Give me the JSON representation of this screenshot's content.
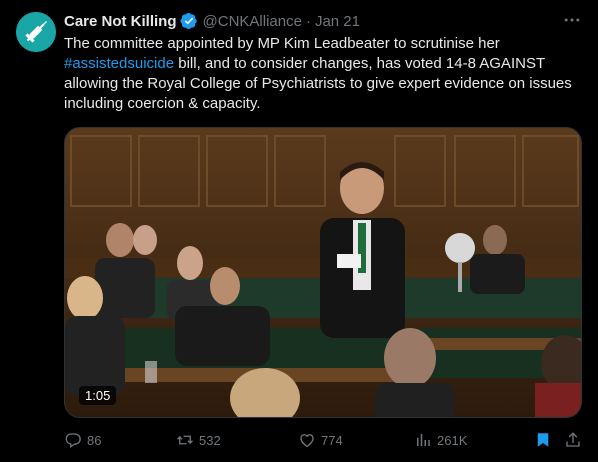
{
  "post": {
    "author_name": "Care Not Killing",
    "handle": "@CNKAlliance",
    "separator": "·",
    "date": "Jan 21",
    "text_part1": "The committee appointed by MP Kim Leadbeater to scrutinise her ",
    "hashtag": "#assistedsuicide",
    "text_part2": " bill, and to consider changes, has voted 14-8 AGAINST allowing the Royal College of Psychiatrists to give expert evidence on issues including coercion & capacity."
  },
  "media": {
    "duration": "1:05"
  },
  "actions": {
    "replies": "86",
    "reposts": "532",
    "likes": "774",
    "views": "261K"
  },
  "colors": {
    "accent": "#1d9bf0",
    "muted": "#71767b",
    "text": "#e7e9ea",
    "avatar_bg": "#1aa6a6"
  },
  "icons": [
    "verified-badge-icon",
    "more-icon",
    "reply-icon",
    "repost-icon",
    "like-icon",
    "views-icon",
    "bookmark-icon",
    "share-icon"
  ]
}
